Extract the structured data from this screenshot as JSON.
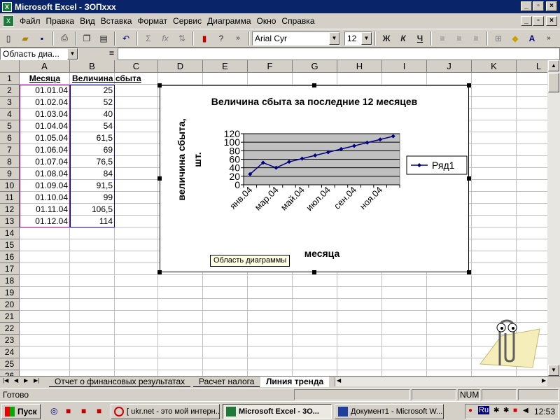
{
  "window": {
    "title": "Microsoft Excel - ЗОПxxx"
  },
  "menu": [
    "Файл",
    "Правка",
    "Вид",
    "Вставка",
    "Формат",
    "Сервис",
    "Диаграмма",
    "Окно",
    "Справка"
  ],
  "toolbar": {
    "font_name": "Arial Cyr",
    "font_size": "12",
    "bold": "Ж",
    "italic": "К",
    "underline": "Ч"
  },
  "formula_bar": {
    "name_box": "Область диа...",
    "equals": "="
  },
  "columns": [
    "A",
    "B",
    "C",
    "D",
    "E",
    "F",
    "G",
    "H",
    "I",
    "J",
    "K",
    "L"
  ],
  "rows": [
    "1",
    "2",
    "3",
    "4",
    "5",
    "6",
    "7",
    "8",
    "9",
    "10",
    "11",
    "12",
    "13",
    "14",
    "15",
    "16",
    "17",
    "18",
    "19",
    "20",
    "21",
    "22",
    "23",
    "24",
    "25",
    "26"
  ],
  "table": {
    "header_a": "Месяца",
    "header_b": "Величина сбыта",
    "dates": [
      "01.01.04",
      "01.02.04",
      "01.03.04",
      "01.04.04",
      "01.05.04",
      "01.06.04",
      "01.07.04",
      "01.08.04",
      "01.09.04",
      "01.10.04",
      "01.11.04",
      "01.12.04"
    ],
    "values": [
      "25",
      "52",
      "40",
      "54",
      "61,5",
      "69",
      "76,5",
      "84",
      "91,5",
      "99",
      "106,5",
      "114"
    ]
  },
  "chart_data": {
    "type": "line",
    "title": "Величина сбыта за последние 12 месяцев",
    "xlabel": "месяца",
    "ylabel": "величина сбыта, шт.",
    "ylim": [
      0,
      120
    ],
    "yticks": [
      "0",
      "20",
      "40",
      "60",
      "80",
      "100",
      "120"
    ],
    "x": [
      "янв.04",
      "фев.04",
      "мар.04",
      "апр.04",
      "май.04",
      "июн.04",
      "июл.04",
      "авг.04",
      "сен.04",
      "окт.04",
      "ноя.04",
      "дек.04"
    ],
    "xtick_labels": [
      "янв.04",
      "мар.04",
      "май.04",
      "июл.04",
      "сен.04",
      "ноя.04"
    ],
    "series": [
      {
        "name": "Ряд1",
        "values": [
          25,
          52,
          40,
          54,
          61.5,
          69,
          76.5,
          84,
          91.5,
          99,
          106.5,
          114
        ]
      }
    ],
    "grid": true,
    "legend": "right",
    "colors": {
      "plot_bg": "#c0c0c0",
      "line": "#000080"
    }
  },
  "tooltip": "Область диаграммы",
  "sheet_tabs": [
    "Отчет о финансовых результатах",
    "Расчет налога",
    "Линия тренда"
  ],
  "status": {
    "ready": "Готово",
    "num": "NUM"
  },
  "taskbar": {
    "start": "Пуск",
    "items": [
      "[ ukr.net - это мой интерн...",
      "Microsoft Excel - 3О...",
      "Документ1 - Microsoft W..."
    ],
    "lang": "Ru",
    "clock": "12:53"
  }
}
